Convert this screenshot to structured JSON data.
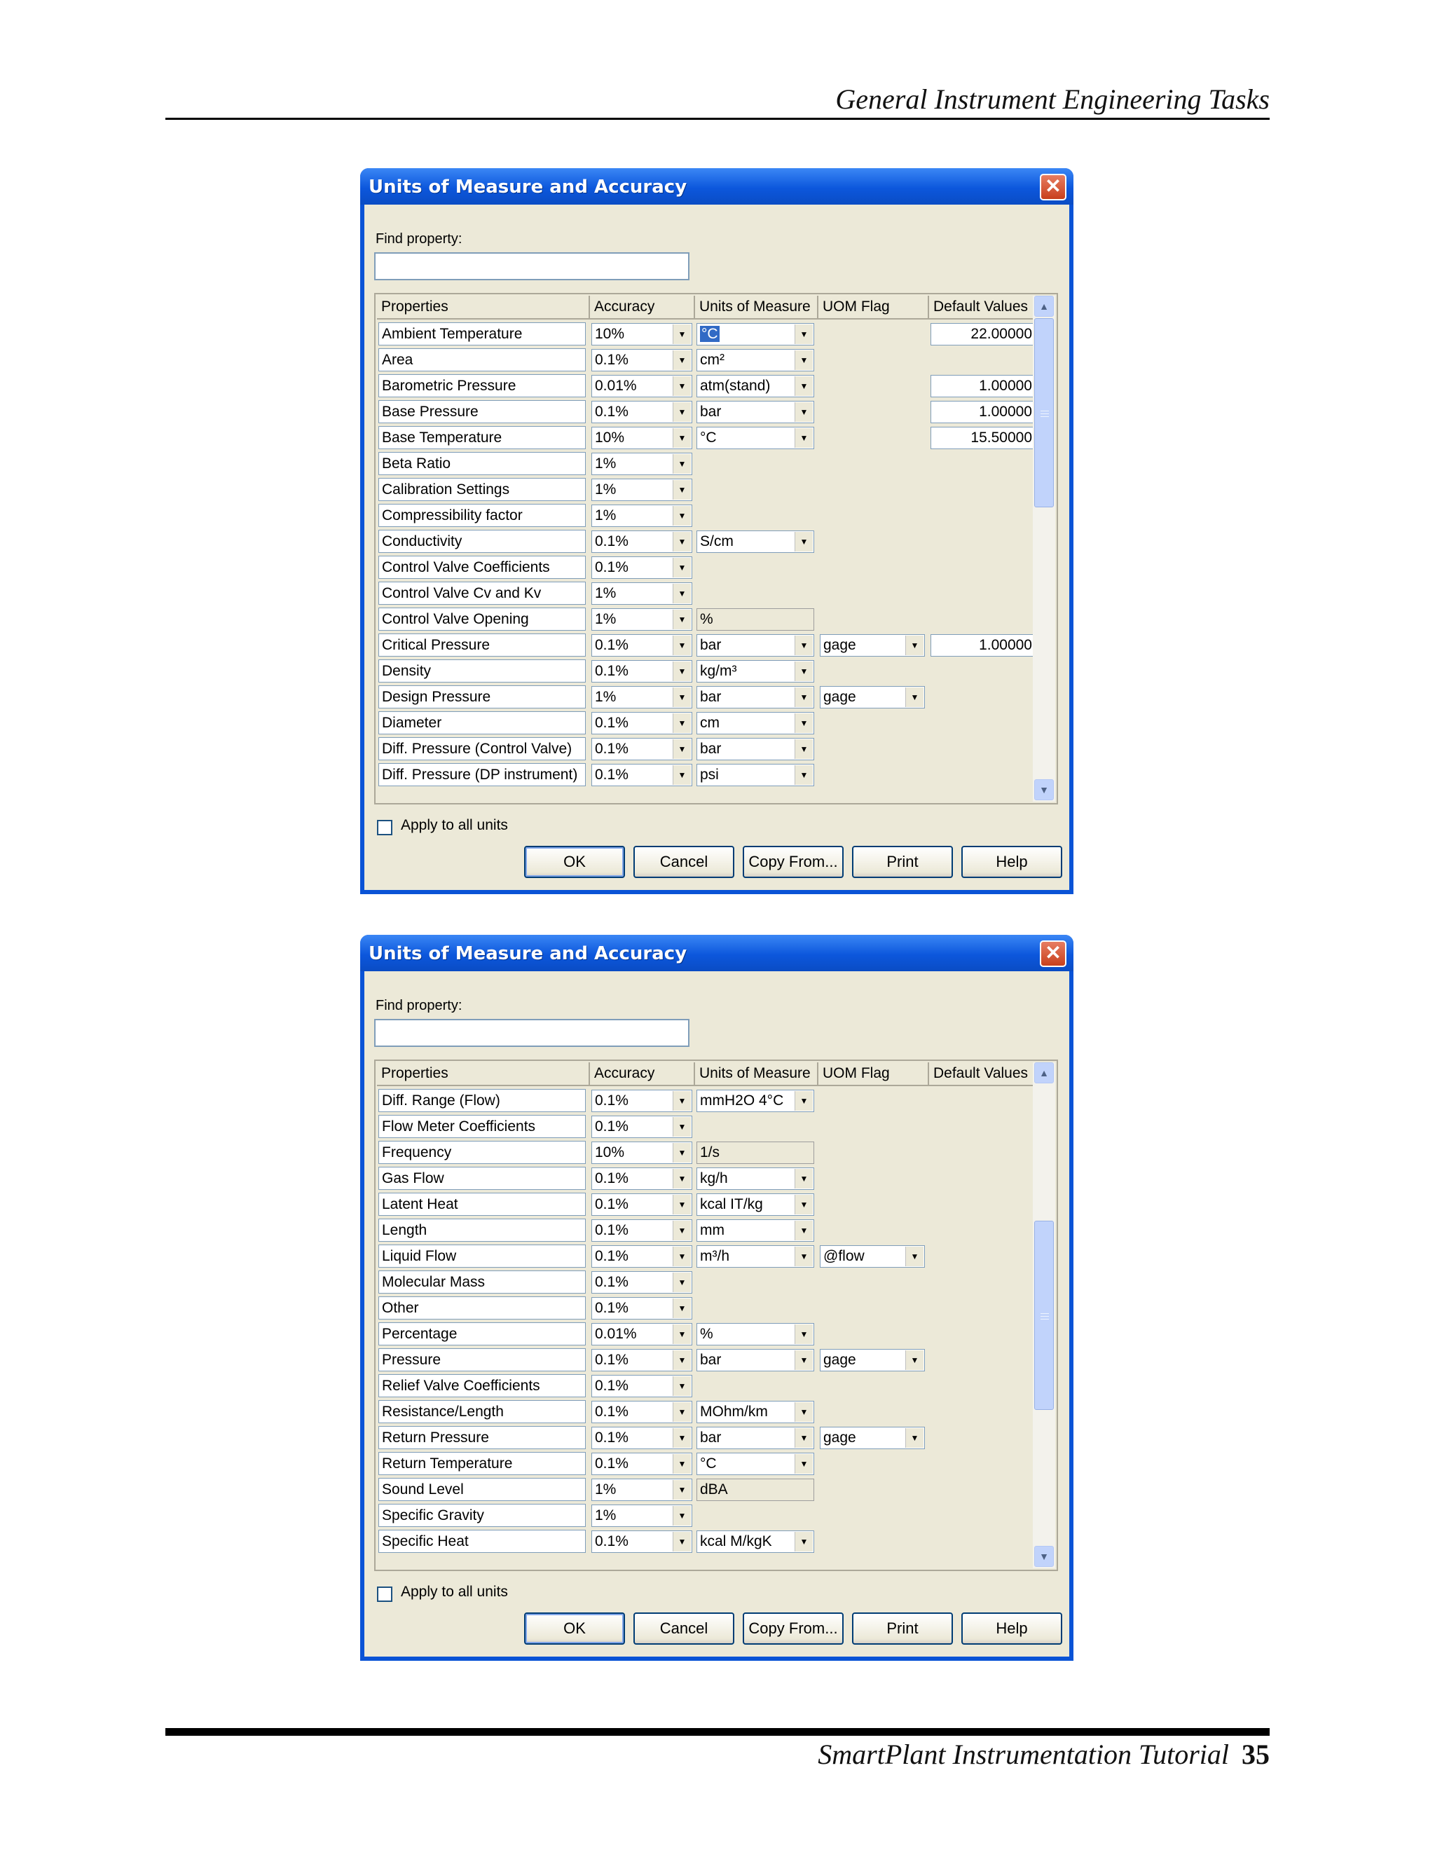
{
  "page": {
    "running_head": "General Instrument Engineering Tasks",
    "footer_title": "SmartPlant Instrumentation Tutorial",
    "page_number": "35"
  },
  "dialogs": [
    {
      "title": "Units of Measure and Accuracy",
      "close_icon": "close-icon",
      "find_label": "Find property:",
      "find_value": "",
      "columns": [
        "Properties",
        "Accuracy",
        "Units of Measure",
        "UOM Flag",
        "Default Values"
      ],
      "rows": [
        {
          "property": "Ambient Temperature",
          "accuracy": "10%",
          "uom": "°C",
          "uom_selected": true,
          "uom_kind": "combo",
          "flag": "",
          "default": "22.00000"
        },
        {
          "property": "Area",
          "accuracy": "0.1%",
          "uom": "cm²",
          "uom_kind": "combo",
          "flag": "",
          "default": ""
        },
        {
          "property": "Barometric Pressure",
          "accuracy": "0.01%",
          "uom": "atm(stand)",
          "uom_kind": "combo",
          "flag": "",
          "default": "1.00000"
        },
        {
          "property": "Base Pressure",
          "accuracy": "0.1%",
          "uom": "bar",
          "uom_kind": "combo",
          "flag": "",
          "default": "1.00000"
        },
        {
          "property": "Base Temperature",
          "accuracy": "10%",
          "uom": "°C",
          "uom_kind": "combo",
          "flag": "",
          "default": "15.50000"
        },
        {
          "property": "Beta Ratio",
          "accuracy": "1%",
          "uom": "",
          "uom_kind": "none",
          "flag": "",
          "default": ""
        },
        {
          "property": "Calibration Settings",
          "accuracy": "1%",
          "uom": "",
          "uom_kind": "none",
          "flag": "",
          "default": ""
        },
        {
          "property": "Compressibility factor",
          "accuracy": "1%",
          "uom": "",
          "uom_kind": "none",
          "flag": "",
          "default": ""
        },
        {
          "property": "Conductivity",
          "accuracy": "0.1%",
          "uom": "S/cm",
          "uom_kind": "combo",
          "flag": "",
          "default": ""
        },
        {
          "property": "Control Valve Coefficients",
          "accuracy": "0.1%",
          "uom": "",
          "uom_kind": "none",
          "flag": "",
          "default": ""
        },
        {
          "property": "Control Valve Cv and Kv",
          "accuracy": "1%",
          "uom": "",
          "uom_kind": "none",
          "flag": "",
          "default": ""
        },
        {
          "property": "Control Valve Opening",
          "accuracy": "1%",
          "uom": "%",
          "uom_kind": "static",
          "flag": "",
          "default": ""
        },
        {
          "property": "Critical Pressure",
          "accuracy": "0.1%",
          "uom": "bar",
          "uom_kind": "combo",
          "flag": "gage",
          "default": "1.00000"
        },
        {
          "property": "Density",
          "accuracy": "0.1%",
          "uom": "kg/m³",
          "uom_kind": "combo",
          "flag": "",
          "default": ""
        },
        {
          "property": "Design Pressure",
          "accuracy": "1%",
          "uom": "bar",
          "uom_kind": "combo",
          "flag": "gage",
          "default": ""
        },
        {
          "property": "Diameter",
          "accuracy": "0.1%",
          "uom": "cm",
          "uom_kind": "combo",
          "flag": "",
          "default": ""
        },
        {
          "property": "Diff. Pressure (Control Valve)",
          "accuracy": "0.1%",
          "uom": "bar",
          "uom_kind": "combo",
          "flag": "",
          "default": ""
        },
        {
          "property": "Diff. Pressure (DP instrument)",
          "accuracy": "0.1%",
          "uom": "psi",
          "uom_kind": "combo",
          "flag": "",
          "default": ""
        }
      ],
      "scroll_position": 0.0,
      "apply_all_label": "Apply to all units",
      "apply_all_checked": false,
      "buttons": [
        "OK",
        "Cancel",
        "Copy From...",
        "Print",
        "Help"
      ]
    },
    {
      "title": "Units of Measure and Accuracy",
      "close_icon": "close-icon",
      "find_label": "Find property:",
      "find_value": "",
      "columns": [
        "Properties",
        "Accuracy",
        "Units of Measure",
        "UOM Flag",
        "Default Values"
      ],
      "rows": [
        {
          "property": "Diff. Range (Flow)",
          "accuracy": "0.1%",
          "uom": "mmH2O 4°C",
          "uom_kind": "combo",
          "flag": "",
          "default": ""
        },
        {
          "property": "Flow Meter Coefficients",
          "accuracy": "0.1%",
          "uom": "",
          "uom_kind": "none",
          "flag": "",
          "default": ""
        },
        {
          "property": "Frequency",
          "accuracy": "10%",
          "uom": "1/s",
          "uom_kind": "static",
          "flag": "",
          "default": ""
        },
        {
          "property": "Gas Flow",
          "accuracy": "0.1%",
          "uom": "kg/h",
          "uom_kind": "combo",
          "flag": "",
          "default": ""
        },
        {
          "property": "Latent Heat",
          "accuracy": "0.1%",
          "uom": "kcal IT/kg",
          "uom_kind": "combo",
          "flag": "",
          "default": ""
        },
        {
          "property": "Length",
          "accuracy": "0.1%",
          "uom": "mm",
          "uom_kind": "combo",
          "flag": "",
          "default": ""
        },
        {
          "property": "Liquid Flow",
          "accuracy": "0.1%",
          "uom": "m³/h",
          "uom_kind": "combo",
          "flag": "@flow",
          "default": ""
        },
        {
          "property": "Molecular Mass",
          "accuracy": "0.1%",
          "uom": "",
          "uom_kind": "none",
          "flag": "",
          "default": ""
        },
        {
          "property": "Other",
          "accuracy": "0.1%",
          "uom": "",
          "uom_kind": "none",
          "flag": "",
          "default": ""
        },
        {
          "property": "Percentage",
          "accuracy": "0.01%",
          "uom": "%",
          "uom_kind": "combo",
          "flag": "",
          "default": ""
        },
        {
          "property": "Pressure",
          "accuracy": "0.1%",
          "uom": "bar",
          "uom_kind": "combo",
          "flag": "gage",
          "default": ""
        },
        {
          "property": "Relief Valve Coefficients",
          "accuracy": "0.1%",
          "uom": "",
          "uom_kind": "none",
          "flag": "",
          "default": ""
        },
        {
          "property": "Resistance/Length",
          "accuracy": "0.1%",
          "uom": "MOhm/km",
          "uom_kind": "combo",
          "flag": "",
          "default": ""
        },
        {
          "property": "Return Pressure",
          "accuracy": "0.1%",
          "uom": "bar",
          "uom_kind": "combo",
          "flag": "gage",
          "default": ""
        },
        {
          "property": "Return Temperature",
          "accuracy": "0.1%",
          "uom": "°C",
          "uom_kind": "combo",
          "flag": "",
          "default": ""
        },
        {
          "property": "Sound Level",
          "accuracy": "1%",
          "uom": "dBA",
          "uom_kind": "static",
          "flag": "",
          "default": ""
        },
        {
          "property": "Specific Gravity",
          "accuracy": "1%",
          "uom": "",
          "uom_kind": "none",
          "flag": "",
          "default": ""
        },
        {
          "property": "Specific Heat",
          "accuracy": "0.1%",
          "uom": "kcal M/kgK",
          "uom_kind": "combo",
          "flag": "",
          "default": ""
        }
      ],
      "scroll_position": 0.5,
      "apply_all_label": "Apply to all units",
      "apply_all_checked": false,
      "buttons": [
        "OK",
        "Cancel",
        "Copy From...",
        "Print",
        "Help"
      ]
    }
  ]
}
